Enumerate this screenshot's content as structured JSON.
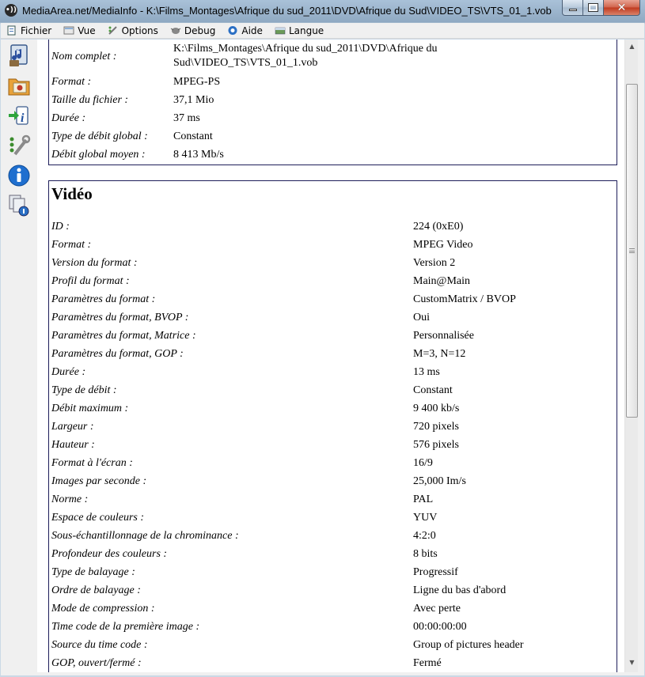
{
  "window": {
    "title": "MediaArea.net/MediaInfo - K:\\Films_Montages\\Afrique du sud_2011\\DVD\\Afrique du Sud\\VIDEO_TS\\VTS_01_1.vob",
    "app_icon_glyph": "•))"
  },
  "menu": [
    {
      "label": "Fichier",
      "icon": "file-icon"
    },
    {
      "label": "Vue",
      "icon": "view-icon"
    },
    {
      "label": "Options",
      "icon": "options-icon"
    },
    {
      "label": "Debug",
      "icon": "debug-icon"
    },
    {
      "label": "Aide",
      "icon": "help-icon"
    },
    {
      "label": "Langue",
      "icon": "language-icon"
    }
  ],
  "toolbar_icons": [
    "open-file-icon",
    "open-folder-icon",
    "export-info-icon",
    "preferences-icon",
    "about-icon",
    "knowledge-base-icon"
  ],
  "general": {
    "rows": [
      {
        "label": "Nom complet :",
        "value": "K:\\Films_Montages\\Afrique du sud_2011\\DVD\\Afrique du",
        "value2": "Sud\\VIDEO_TS\\VTS_01_1.vob"
      },
      {
        "label": "Format :",
        "value": "MPEG-PS"
      },
      {
        "label": "Taille du fichier :",
        "value": "37,1 Mio"
      },
      {
        "label": "Durée :",
        "value": "37 ms"
      },
      {
        "label": "Type de débit global :",
        "value": "Constant"
      },
      {
        "label": "Débit global moyen :",
        "value": "8 413 Mb/s"
      }
    ]
  },
  "video": {
    "title": "Vidéo",
    "rows": [
      {
        "label": "ID :",
        "value": "224 (0xE0)"
      },
      {
        "label": "Format :",
        "value": "MPEG Video"
      },
      {
        "label": "Version du format :",
        "value": "Version 2"
      },
      {
        "label": "Profil du format :",
        "value": "Main@Main"
      },
      {
        "label": "Paramètres du format :",
        "value": "CustomMatrix / BVOP"
      },
      {
        "label": "Paramètres du format, BVOP :",
        "value": "Oui"
      },
      {
        "label": "Paramètres du format, Matrice :",
        "value": "Personnalisée"
      },
      {
        "label": "Paramètres du format, GOP :",
        "value": "M=3, N=12"
      },
      {
        "label": "Durée :",
        "value": "13 ms"
      },
      {
        "label": "Type de débit :",
        "value": "Constant"
      },
      {
        "label": "Débit maximum :",
        "value": "9 400 kb/s"
      },
      {
        "label": "Largeur :",
        "value": "720 pixels"
      },
      {
        "label": "Hauteur :",
        "value": "576 pixels"
      },
      {
        "label": "Format à l'écran :",
        "value": "16/9"
      },
      {
        "label": "Images par seconde :",
        "value": "25,000 Im/s"
      },
      {
        "label": "Norme :",
        "value": "PAL"
      },
      {
        "label": "Espace de couleurs :",
        "value": "YUV"
      },
      {
        "label": "Sous-échantillonnage de la chrominance :",
        "value": "4:2:0"
      },
      {
        "label": "Profondeur des couleurs :",
        "value": "8 bits"
      },
      {
        "label": "Type de balayage :",
        "value": "Progressif"
      },
      {
        "label": "Ordre de balayage :",
        "value": "Ligne du bas d'abord"
      },
      {
        "label": "Mode de compression :",
        "value": "Avec perte"
      },
      {
        "label": "Time code de la première image :",
        "value": "00:00:00:00"
      },
      {
        "label": "Source du time code :",
        "value": "Group of pictures header"
      },
      {
        "label": "GOP, ouvert/fermé :",
        "value": "Fermé"
      }
    ]
  },
  "window_controls": {
    "minimize": "▁",
    "maximize": "□",
    "close": "✕"
  },
  "scrollbar": {
    "up": "▲",
    "down": "▼"
  }
}
